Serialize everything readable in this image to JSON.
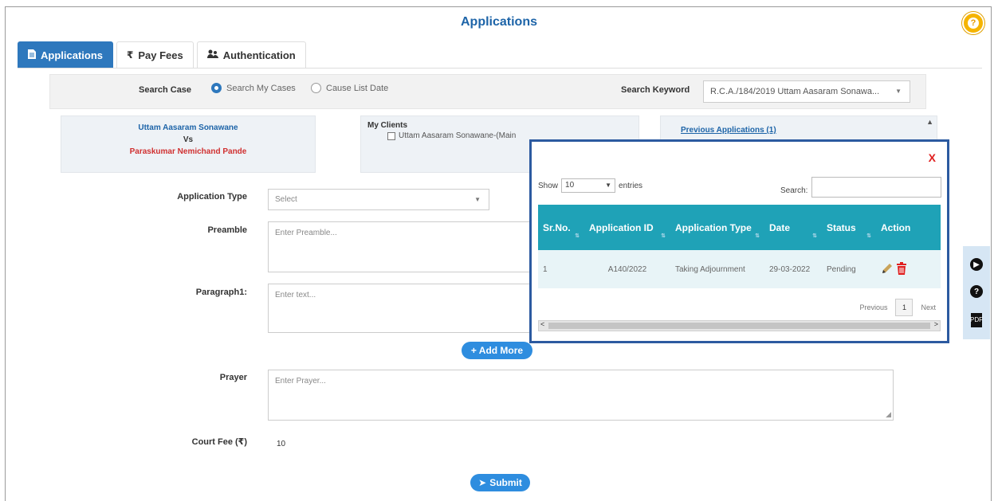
{
  "page": {
    "title": "Applications"
  },
  "tabs": [
    {
      "label": "Applications",
      "icon": "document-icon",
      "active": true
    },
    {
      "label": "Pay Fees",
      "icon": "rupee-icon",
      "symbol": "₹",
      "active": false
    },
    {
      "label": "Authentication",
      "icon": "users-icon",
      "active": false
    }
  ],
  "search": {
    "case_label": "Search Case",
    "option_my_cases": "Search My Cases",
    "option_cause_list": "Cause List Date",
    "keyword_label": "Search Keyword",
    "keyword_value": "R.C.A./184/2019 Uttam Aasaram Sonawa..."
  },
  "parties": {
    "petitioner": "Uttam Aasaram Sonawane",
    "vs": "Vs",
    "respondent": "Paraskumar Nemichand Pande"
  },
  "clients": {
    "title": "My Clients",
    "client_1": "Uttam Aasaram Sonawane-(Main"
  },
  "previous": {
    "link": "Previous Applications (1)"
  },
  "form": {
    "app_type_label": "Application Type",
    "app_type_value": "Select",
    "preamble_label": "Preamble",
    "preamble_placeholder": "Enter Preamble...",
    "para_label": "Paragraph1:",
    "para_placeholder": "Enter text...",
    "add_more": "+ Add More",
    "prayer_label": "Prayer",
    "prayer_placeholder": "Enter Prayer...",
    "fee_label": "Court Fee (₹)",
    "fee_value": "10",
    "submit": "Submit"
  },
  "modal": {
    "close": "X",
    "show": "Show",
    "entries_value": "10",
    "entries": "entries",
    "search_label": "Search:",
    "columns": [
      "Sr.No.",
      "Application ID",
      "Application Type",
      "Date",
      "Status",
      "Action"
    ],
    "rows": [
      {
        "sr": "1",
        "id": "A140/2022",
        "type": "Taking Adjournment",
        "date": "29-03-2022",
        "status": "Pending"
      }
    ],
    "previous": "Previous",
    "page": "1",
    "next": "Next"
  },
  "colors": {
    "primary": "#2e78bd",
    "table_header": "#1fa2b7",
    "danger": "#d03030",
    "modal_border": "#2c5aa0"
  }
}
